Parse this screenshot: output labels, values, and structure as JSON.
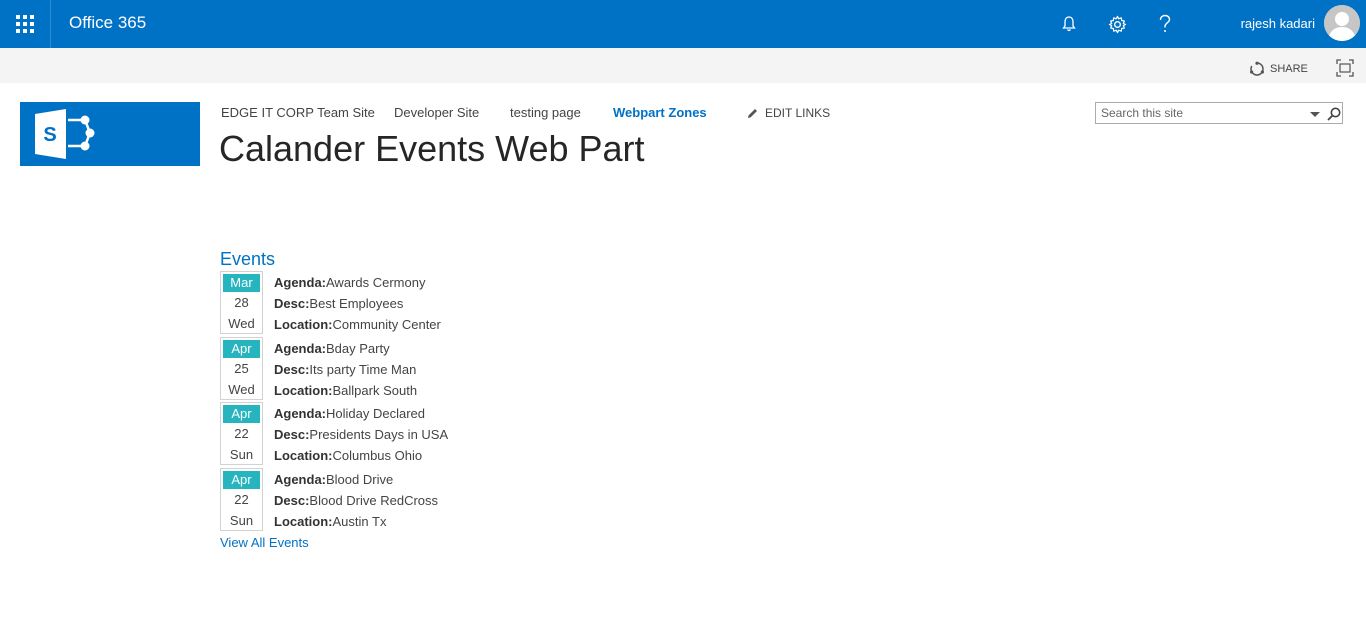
{
  "suite_bar": {
    "brand": "Office 365",
    "user_name": "rajesh kadari"
  },
  "ribbon": {
    "share_label": "SHARE"
  },
  "site": {
    "nav": [
      "EDGE IT CORP Team Site",
      "Developer Site",
      "testing page",
      "Webpart Zones"
    ],
    "selected_nav": "Webpart Zones",
    "edit_links_label": "EDIT LINKS",
    "page_title": "Calander Events Web Part",
    "search_placeholder": "Search this site"
  },
  "events": {
    "title": "Events",
    "labels": {
      "agenda": "Agenda:",
      "desc": "Desc:",
      "location": "Location:"
    },
    "items": [
      {
        "month": "Mar",
        "day": "28",
        "dow": "Wed",
        "agenda": "Awards Cermony",
        "desc": "Best Employees",
        "location": "Community Center"
      },
      {
        "month": "Apr",
        "day": "25",
        "dow": "Wed",
        "agenda": "Bday Party",
        "desc": "Its party Time Man",
        "location": "Ballpark South"
      },
      {
        "month": "Apr",
        "day": "22",
        "dow": "Sun",
        "agenda": "Holiday Declared",
        "desc": "Presidents Days in USA",
        "location": "Columbus Ohio"
      },
      {
        "month": "Apr",
        "day": "22",
        "dow": "Sun",
        "agenda": "Blood Drive",
        "desc": "Blood Drive RedCross",
        "location": "Austin Tx"
      }
    ],
    "view_all_label": "View All Events"
  },
  "colors": {
    "suite_bar": "#0072c6",
    "accent": "#0072c6",
    "month_badge": "#26b5bf",
    "ribbon": "#f4f4f4"
  },
  "icons": [
    "app-launcher-icon",
    "bell-icon",
    "gear-icon",
    "help-icon",
    "share-icon",
    "focus-icon",
    "pencil-icon",
    "dropdown-caret-icon",
    "search-icon",
    "sharepoint-logo"
  ]
}
